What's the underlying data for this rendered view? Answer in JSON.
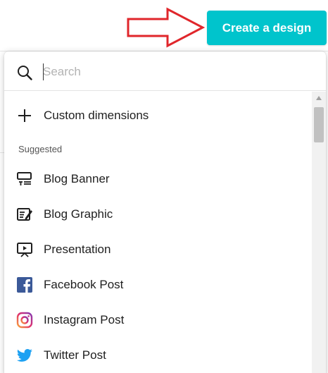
{
  "header": {
    "create_button_label": "Create a design"
  },
  "search": {
    "value": "",
    "placeholder": "Search"
  },
  "menu": {
    "custom_dimensions_label": "Custom dimensions",
    "section_label": "Suggested",
    "items": [
      {
        "label": "Blog Banner",
        "icon": "blog-banner-icon"
      },
      {
        "label": "Blog Graphic",
        "icon": "blog-graphic-icon"
      },
      {
        "label": "Presentation",
        "icon": "presentation-icon"
      },
      {
        "label": "Facebook Post",
        "icon": "facebook-icon"
      },
      {
        "label": "Instagram Post",
        "icon": "instagram-icon"
      },
      {
        "label": "Twitter Post",
        "icon": "twitter-icon"
      }
    ]
  },
  "colors": {
    "accent": "#00c4cc",
    "annotation_arrow": "#e0262b",
    "facebook": "#3b5998",
    "twitter": "#1da1f2"
  }
}
